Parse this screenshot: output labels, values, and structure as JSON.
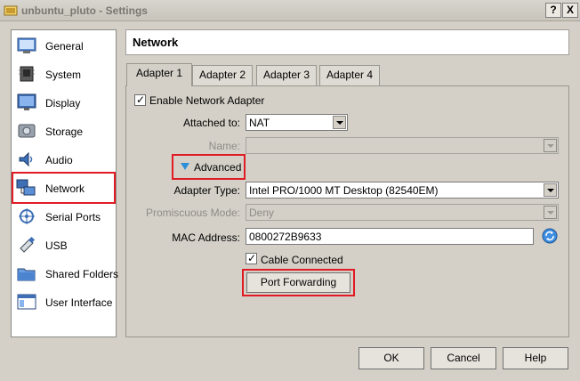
{
  "window": {
    "title": "unbuntu_pluto - Settings",
    "help_button": "?",
    "close_button": "X"
  },
  "sidebar": {
    "items": [
      {
        "label": "General",
        "icon": "general-icon"
      },
      {
        "label": "System",
        "icon": "system-icon"
      },
      {
        "label": "Display",
        "icon": "display-icon"
      },
      {
        "label": "Storage",
        "icon": "storage-icon"
      },
      {
        "label": "Audio",
        "icon": "audio-icon"
      },
      {
        "label": "Network",
        "icon": "network-icon",
        "selected": true
      },
      {
        "label": "Serial Ports",
        "icon": "serial-ports-icon"
      },
      {
        "label": "USB",
        "icon": "usb-icon"
      },
      {
        "label": "Shared Folders",
        "icon": "shared-folders-icon"
      },
      {
        "label": "User Interface",
        "icon": "user-interface-icon"
      }
    ]
  },
  "page": {
    "title": "Network"
  },
  "tabs": [
    {
      "label": "Adapter 1",
      "active": true
    },
    {
      "label": "Adapter 2"
    },
    {
      "label": "Adapter 3"
    },
    {
      "label": "Adapter 4"
    }
  ],
  "adapter": {
    "enable_label": "Enable Network Adapter",
    "enable_checked": true,
    "attached_to_label": "Attached to:",
    "attached_to_value": "NAT",
    "name_label": "Name:",
    "name_value": "",
    "advanced_label": "Advanced",
    "adapter_type_label": "Adapter Type:",
    "adapter_type_value": "Intel PRO/1000 MT Desktop (82540EM)",
    "promiscuous_label": "Promiscuous Mode:",
    "promiscuous_value": "Deny",
    "mac_label": "MAC Address:",
    "mac_value": "0800272B9633",
    "cable_label": "Cable Connected",
    "cable_checked": true,
    "port_forwarding_label": "Port Forwarding"
  },
  "footer": {
    "ok_label": "OK",
    "cancel_label": "Cancel",
    "help_label": "Help"
  },
  "colors": {
    "highlight": "#e01b24",
    "background": "#d4d0c8"
  }
}
